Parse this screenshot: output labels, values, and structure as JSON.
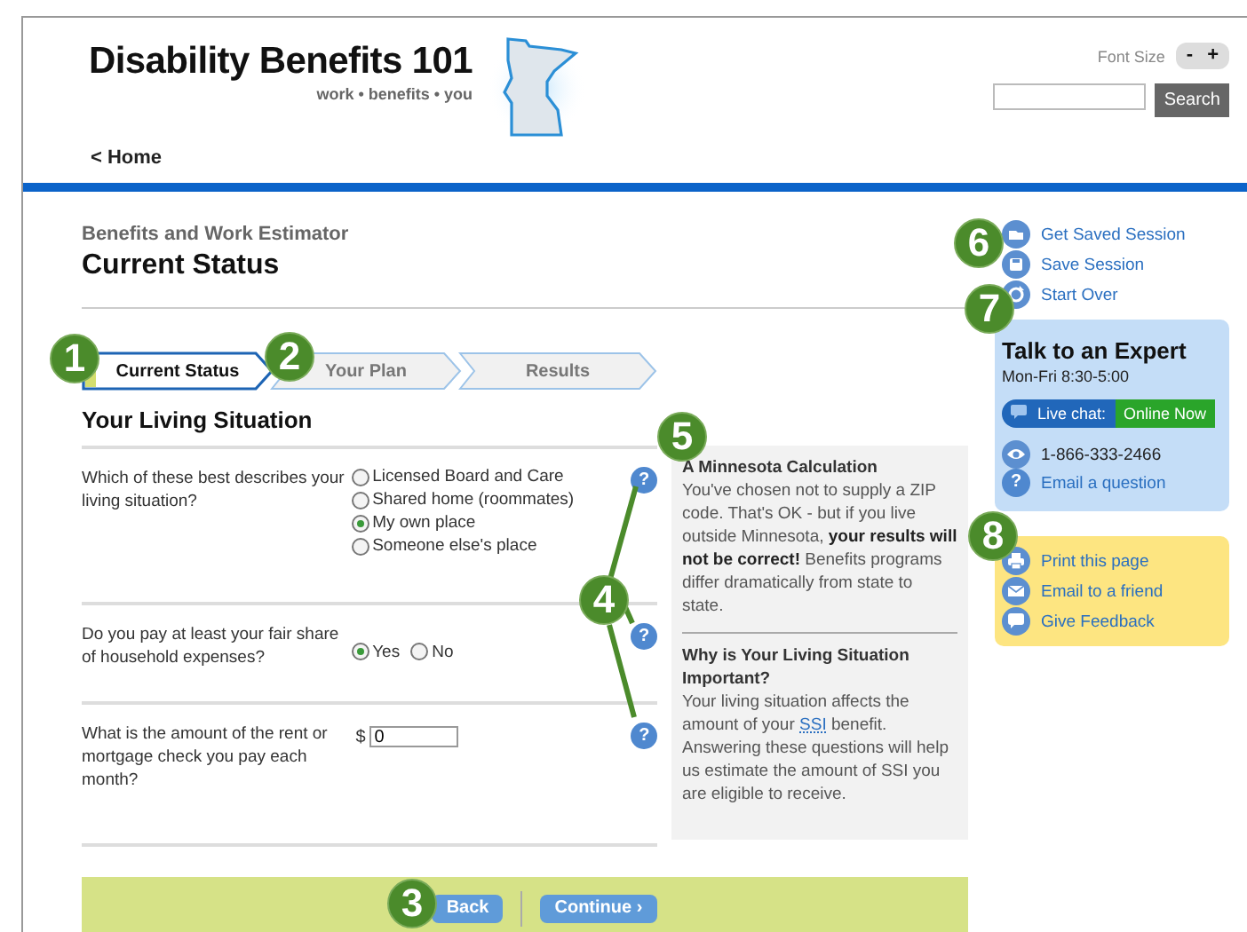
{
  "header": {
    "site_title": "Disability Benefits 101",
    "tagline": "work • benefits • you",
    "font_size_label": "Font Size",
    "font_buttons": [
      "-",
      "+"
    ],
    "search_button": "Search"
  },
  "nav": {
    "home_link": "< Home"
  },
  "page": {
    "section": "Benefits and Work Estimator",
    "title": "Current Status"
  },
  "steps": [
    {
      "label": "Current Status",
      "selected": true
    },
    {
      "label": "Your Plan",
      "selected": false
    },
    {
      "label": "Results",
      "selected": false
    }
  ],
  "form": {
    "heading": "Your Living Situation",
    "questions": [
      {
        "kind": "radio",
        "text": "Which of these best describes your living situation?",
        "help": "?",
        "options": [
          {
            "label": "Licensed Board and Care",
            "selected": false
          },
          {
            "label": "Shared home (roommates)",
            "selected": false
          },
          {
            "label": "My own place",
            "selected": true
          },
          {
            "label": "Someone else's place",
            "selected": false
          }
        ]
      },
      {
        "kind": "radio-inline",
        "text": "Do you pay at least your fair share of household expenses?",
        "help": "?",
        "options": [
          {
            "label": "Yes",
            "selected": true
          },
          {
            "label": "No",
            "selected": false
          }
        ]
      },
      {
        "kind": "amount",
        "text": "What is the amount of the rent or mortgage check you pay each month?",
        "help": "?",
        "prefix": "$",
        "value": "0"
      }
    ]
  },
  "info_panel": [
    {
      "title": "A Minnesota Calculation",
      "body": "You've chosen not to supply a ZIP code. That's OK - but if you live outside Minnesota, **your results will not be correct!** Benefits programs differ dramatically from state to state."
    },
    {
      "title": "Why is Your Living Situation Important?",
      "body_before": "Your living situation affects the amount of your",
      "link": "SSI",
      "body_after": "benefit. Answering these questions will help us estimate the amount of SSI you are eligible to receive."
    }
  ],
  "footer_buttons": [
    "Back",
    "Continue ›"
  ],
  "session_links": [
    {
      "kind": "folder",
      "label": "Get Saved Session"
    },
    {
      "kind": "save",
      "label": "Save Session"
    },
    {
      "kind": "restart",
      "label": "Start Over"
    }
  ],
  "expert": {
    "title": "Talk to an Expert",
    "hours": "Mon-Fri 8:30-5:00",
    "chat_label": "Live chat:",
    "chat_status": "Online Now",
    "phone": "1-866-333-2466",
    "email_icon": "?",
    "email_link": "Email a question"
  },
  "share_links": [
    {
      "kind": "print",
      "label": "Print this page"
    },
    {
      "kind": "mail",
      "label": "Email to a friend"
    },
    {
      "kind": "chat",
      "label": "Give Feedback"
    }
  ],
  "callouts": [
    "1",
    "2",
    "3",
    "4",
    "5",
    "6",
    "7",
    "8"
  ]
}
